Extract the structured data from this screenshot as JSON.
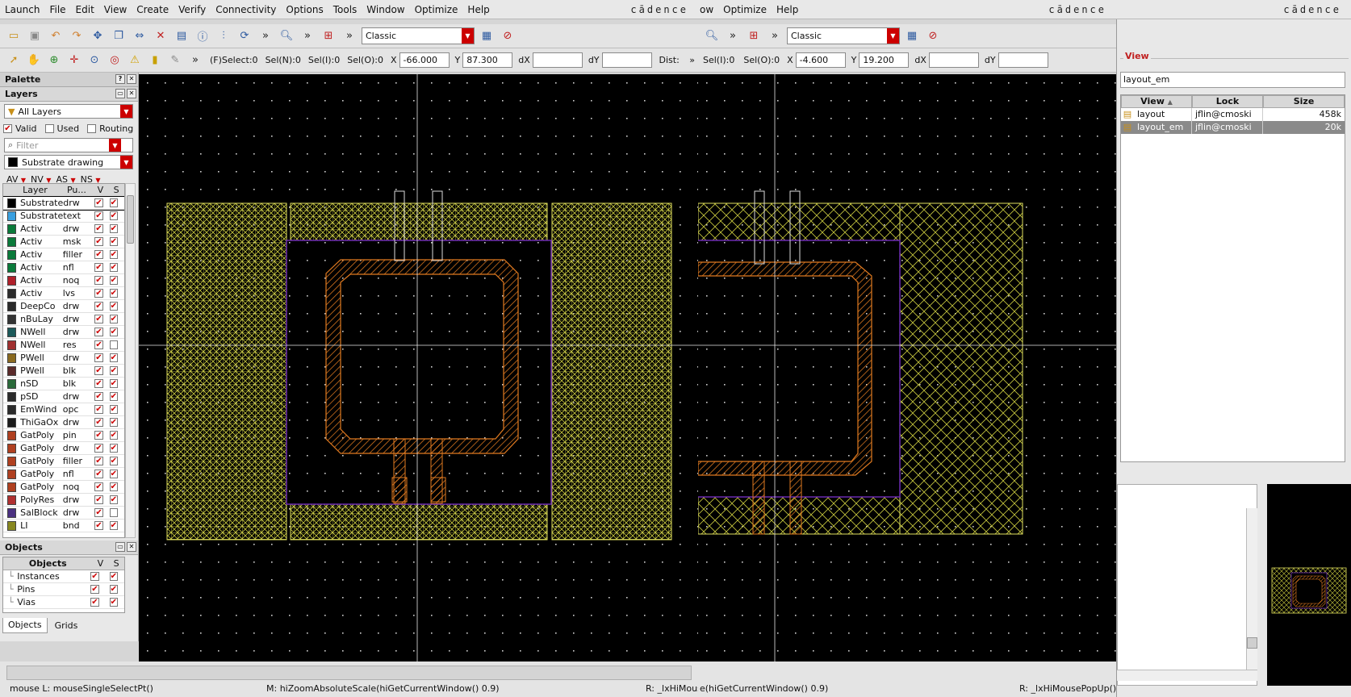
{
  "menubar": {
    "items": [
      "Launch",
      "File",
      "Edit",
      "View",
      "Create",
      "Verify",
      "Connectivity",
      "Options",
      "Tools",
      "Window",
      "Optimize",
      "Help"
    ],
    "items_right": [
      "ow",
      "Optimize",
      "Help"
    ],
    "brand": "cādence"
  },
  "toolbar": {
    "workspace_value": "Classic",
    "workspace_value_right": "Classic"
  },
  "coordbar": {
    "f_select": "(F)Select:0",
    "sel_n": "Sel(N):0",
    "sel_i": "Sel(I):0",
    "sel_o": "Sel(O):0",
    "x_label": "X",
    "x_value": "-66.000",
    "y_label": "Y",
    "y_value": "87.300",
    "dx_label": "dX",
    "dy_label": "dY",
    "dist_label": "Dist:",
    "right_sel_i": "Sel(I):0",
    "right_sel_o": "Sel(O):0",
    "right_x_value": "-4.600",
    "right_y_value": "19.200"
  },
  "palette": {
    "title": "Palette",
    "layers_title": "Layers",
    "filter_dropdown": "All Layers",
    "valid": "Valid",
    "used": "Used",
    "routing": "Routing",
    "filter_placeholder": "Filter",
    "current_layer": "Substrate drawing",
    "col_av": "AV",
    "col_nv": "NV",
    "col_as": "AS",
    "col_ns": "NS",
    "hdr_layer": "Layer",
    "hdr_purpose": "Pu...",
    "hdr_v": "V",
    "hdr_s": "S",
    "layers": [
      {
        "name": "Substrate",
        "purpose": "drw",
        "color": "#000000",
        "v": true,
        "s": true
      },
      {
        "name": "Substrate",
        "purpose": "text",
        "color": "#3aa0e0",
        "v": true,
        "s": true
      },
      {
        "name": "Activ",
        "purpose": "drw",
        "color": "#0a7a3a",
        "v": true,
        "s": true
      },
      {
        "name": "Activ",
        "purpose": "msk",
        "color": "#0a7a3a",
        "v": true,
        "s": true
      },
      {
        "name": "Activ",
        "purpose": "filler",
        "color": "#0a7a3a",
        "v": true,
        "s": true
      },
      {
        "name": "Activ",
        "purpose": "nfl",
        "color": "#0a7a3a",
        "v": true,
        "s": true
      },
      {
        "name": "Activ",
        "purpose": "noq",
        "color": "#b0202a",
        "v": true,
        "s": true
      },
      {
        "name": "Activ",
        "purpose": "lvs",
        "color": "#2a2a2a",
        "v": true,
        "s": true
      },
      {
        "name": "DeepCo",
        "purpose": "drw",
        "color": "#2a2a2a",
        "v": true,
        "s": true
      },
      {
        "name": "nBuLay",
        "purpose": "drw",
        "color": "#333333",
        "v": true,
        "s": true
      },
      {
        "name": "NWell",
        "purpose": "drw",
        "color": "#1c5a5a",
        "v": true,
        "s": true
      },
      {
        "name": "NWell",
        "purpose": "res",
        "color": "#a03030",
        "v": true,
        "s": false
      },
      {
        "name": "PWell",
        "purpose": "drw",
        "color": "#8a6a20",
        "v": true,
        "s": true
      },
      {
        "name": "PWell",
        "purpose": "blk",
        "color": "#5a2a2a",
        "v": true,
        "s": true
      },
      {
        "name": "nSD",
        "purpose": "blk",
        "color": "#2a6a3a",
        "v": true,
        "s": true
      },
      {
        "name": "pSD",
        "purpose": "drw",
        "color": "#2a2a2a",
        "v": true,
        "s": true
      },
      {
        "name": "EmWind",
        "purpose": "opc",
        "color": "#2a2a2a",
        "v": true,
        "s": true
      },
      {
        "name": "ThiGaOx",
        "purpose": "drw",
        "color": "#1a1a1a",
        "v": true,
        "s": true
      },
      {
        "name": "GatPoly",
        "purpose": "pin",
        "color": "#b04020",
        "v": true,
        "s": true
      },
      {
        "name": "GatPoly",
        "purpose": "drw",
        "color": "#b04020",
        "v": true,
        "s": true
      },
      {
        "name": "GatPoly",
        "purpose": "filler",
        "color": "#b04020",
        "v": true,
        "s": true
      },
      {
        "name": "GatPoly",
        "purpose": "nfl",
        "color": "#b04020",
        "v": true,
        "s": true
      },
      {
        "name": "GatPoly",
        "purpose": "noq",
        "color": "#b04020",
        "v": true,
        "s": true
      },
      {
        "name": "PolyRes",
        "purpose": "drw",
        "color": "#b03030",
        "v": true,
        "s": true
      },
      {
        "name": "SalBlock",
        "purpose": "drw",
        "color": "#4a3080",
        "v": true,
        "s": false
      },
      {
        "name": "LI",
        "purpose": "bnd",
        "color": "#888820",
        "v": true,
        "s": true
      }
    ]
  },
  "objects": {
    "title": "Objects",
    "hdr_objects": "Objects",
    "hdr_v": "V",
    "hdr_s": "S",
    "items": [
      "Instances",
      "Pins",
      "Vias"
    ],
    "tab_objects": "Objects",
    "tab_grids": "Grids"
  },
  "status": {
    "left": "mouse L: mouseSingleSelectPt()",
    "middle": "M: hiZoomAbsoluteScale(hiGetCurrentWindow() 0.9)",
    "right": "R: _lxHiMousePopUp()",
    "middle2": "e(hiGetCurrentWindow() 0.9)",
    "right2": "R: _lxHiMousePopUp()"
  },
  "view_panel": {
    "title": "View",
    "input_value": "layout_em",
    "hdr_view": "View",
    "hdr_lock": "Lock",
    "hdr_size": "Size",
    "rows": [
      {
        "view": "layout",
        "lock": "jflin@cmoski",
        "size": "458k",
        "selected": false
      },
      {
        "view": "layout_em",
        "lock": "jflin@cmoski",
        "size": "20k",
        "selected": true
      }
    ]
  },
  "colors": {
    "canvas_bg": "#000000",
    "fill_yellow": "#d8d84a",
    "poly_orange": "#e07a20",
    "purple_outline": "#6a2ab0"
  }
}
